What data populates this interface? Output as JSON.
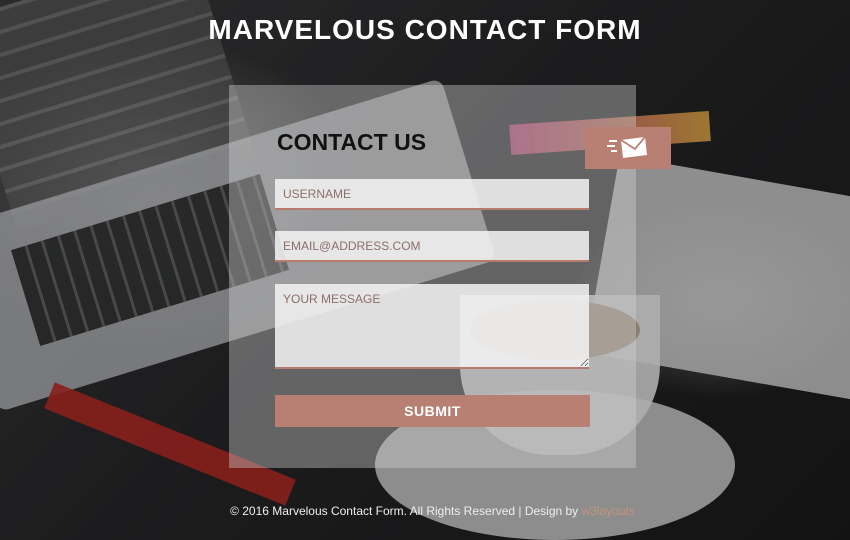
{
  "page": {
    "title": "MARVELOUS CONTACT FORM"
  },
  "form": {
    "heading": "CONTACT US",
    "username_placeholder": "USERNAME",
    "email_placeholder": "EMAIL@ADDRESS.COM",
    "message_placeholder": "YOUR MESSAGE",
    "submit_label": "SUBMIT",
    "mail_icon": "mail-fast-icon"
  },
  "footer": {
    "text": "© 2016 Marvelous Contact Form. All Rights Reserved | Design by",
    "link": "w3layouts"
  },
  "colors": {
    "accent": "#b88073",
    "link": "#c39480"
  }
}
